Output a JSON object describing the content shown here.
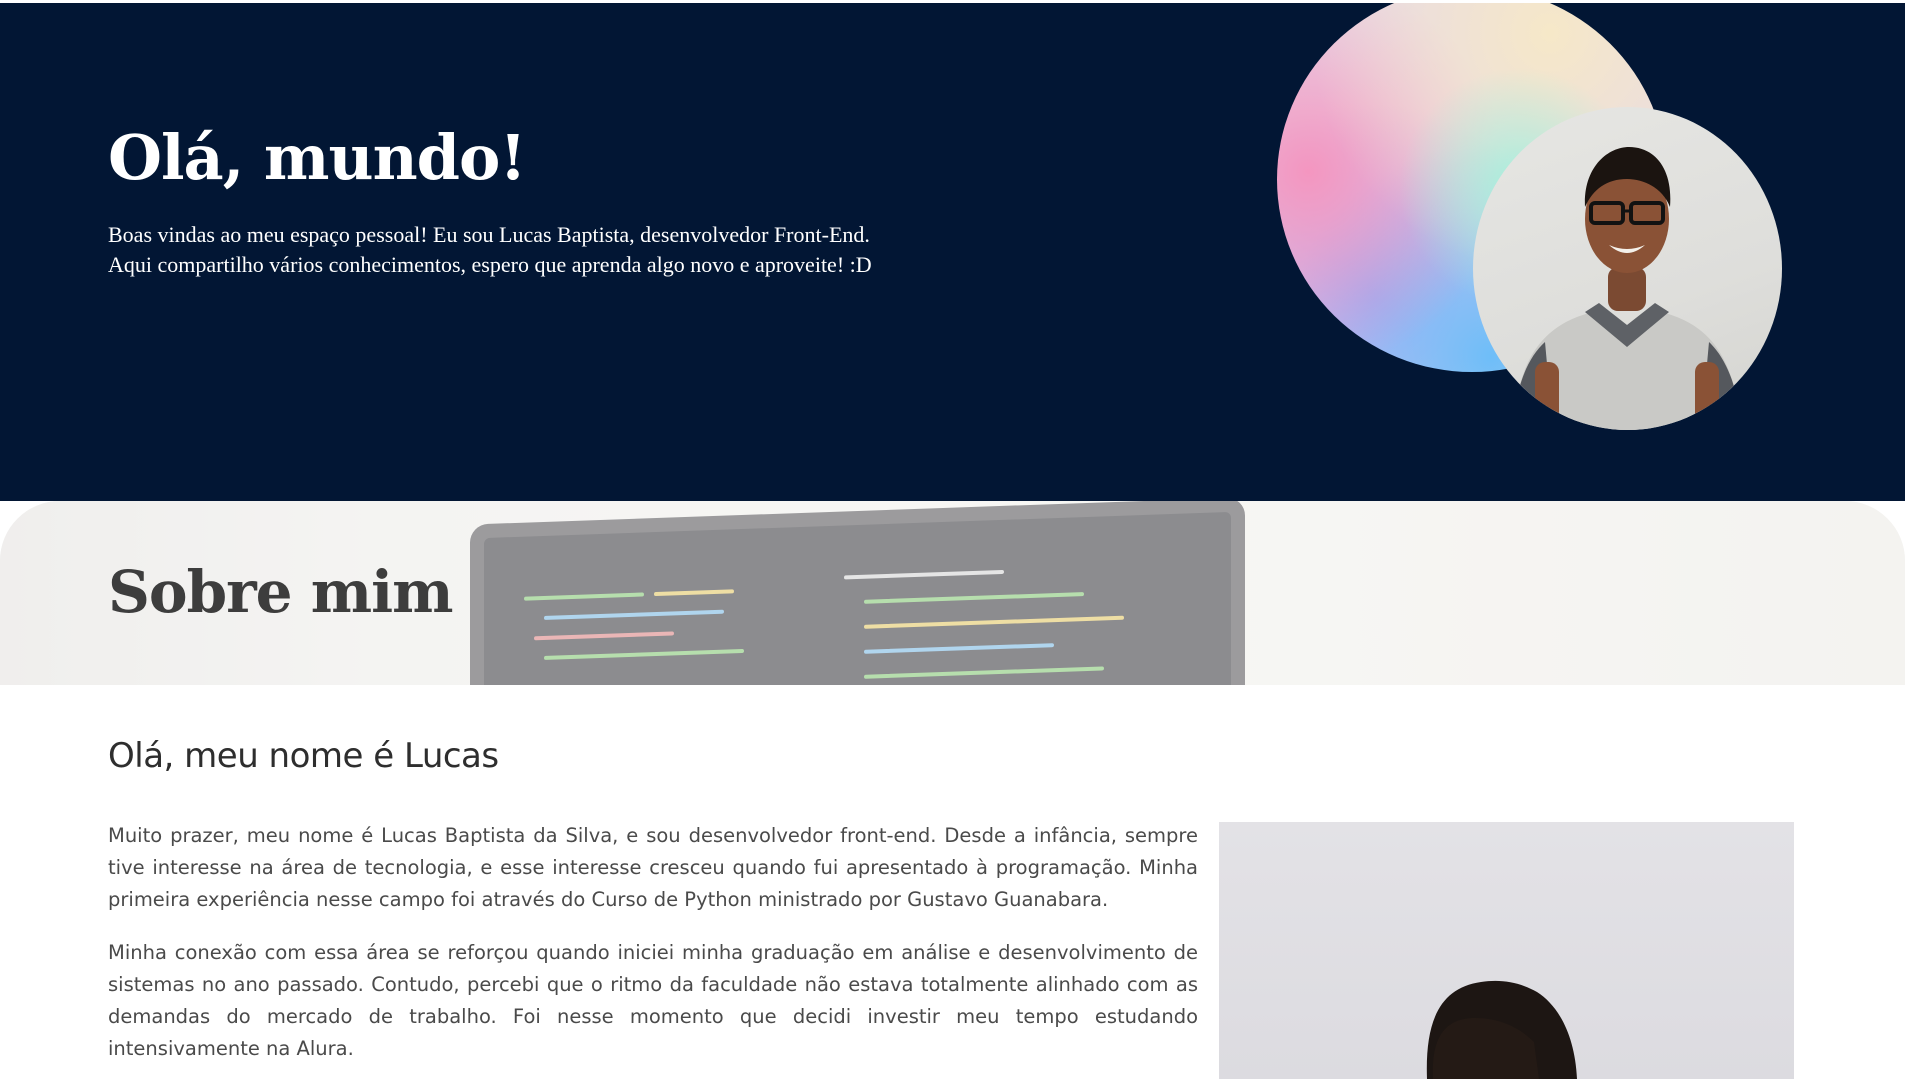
{
  "hero": {
    "title": "Olá, mundo!",
    "intro_line1": "Boas vindas ao meu espaço pessoal! Eu sou Lucas Baptista, desenvolvedor Front-End.",
    "intro_line2": "Aqui compartilho vários conhecimentos, espero que aprenda algo novo e aproveite! :D"
  },
  "about": {
    "title": "Sobre mim",
    "heading": "Olá, meu nome é Lucas",
    "paragraphs": [
      "Muito prazer, meu nome é Lucas Baptista da Silva, e sou desenvolvedor front-end. Desde a infância, sempre tive interesse na área de tecnologia, e esse interesse cresceu quando fui apresentado à programação. Minha primeira experiência nesse campo foi através do Curso de Python ministrado por Gustavo Guanabara.",
      "Minha conexão com essa área se reforçou quando iniciei minha graduação em análise e desenvolvimento de sistemas no ano passado. Contudo, percebi que o ritmo da faculdade não estava totalmente alinhado com as demandas do mercado de trabalho. Foi nesse momento que decidi investir meu tempo estudando intensivamente na Alura."
    ]
  },
  "colors": {
    "hero_background": "#021634",
    "title_text": "#3d3d3d",
    "body_text": "#4a4a4a"
  }
}
